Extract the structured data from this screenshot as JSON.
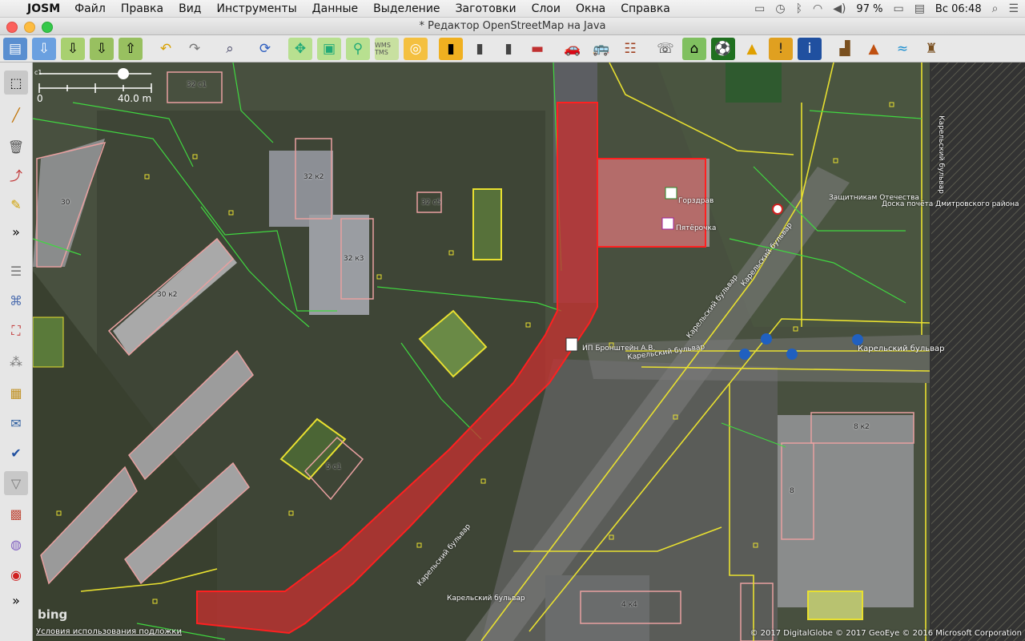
{
  "menubar": {
    "app": "JOSM",
    "items": [
      "Файл",
      "Правка",
      "Вид",
      "Инструменты",
      "Данные",
      "Выделение",
      "Заготовки",
      "Слои",
      "Окна",
      "Справка"
    ],
    "battery": "97 %",
    "clock": "Вс 06:48"
  },
  "window": {
    "title": "* Редактор OpenStreetMap на Java"
  },
  "toolbar": {
    "icons": [
      "open-icon",
      "save-icon",
      "download-icon",
      "download-area-icon",
      "upload-icon",
      "undo-icon",
      "redo-icon",
      "print-icon",
      "refresh-icon",
      "zoom-fit-icon",
      "zoom-selection-icon",
      "zoom-icon",
      "wms-tms-icon",
      "imagery-icon",
      "crossing-icon",
      "traffic-signal-icon",
      "barrier-icon",
      "wall-icon",
      "car-icon",
      "bus-icon",
      "railway-icon",
      "phone-icon",
      "building-icon",
      "sport-icon",
      "shop-icon",
      "warning-icon",
      "info-icon",
      "industrial-icon",
      "peak-icon",
      "water-icon",
      "castle-icon"
    ],
    "wms_label": "WMS TMS"
  },
  "left_tools": [
    "select-icon",
    "draw-way-icon",
    "delete-icon",
    "connect-icon",
    "pencil-icon",
    "more-icon",
    "layers-icon",
    "tag-icon",
    "relation-icon",
    "validator-icon",
    "notes-icon",
    "mail-icon",
    "check-icon",
    "filter-icon",
    "preset-icon",
    "style-icon",
    "map-marker-icon",
    "more-icon"
  ],
  "map": {
    "scale_zero": "0",
    "scale_len": "40.0 m",
    "scale_label_top": "c1",
    "bing": "bing",
    "terms": "Условия использования подложки",
    "attribution": "© 2017 DigitalGlobe © 2017 GeoEye © 2016 Microsoft Corporation",
    "labels": [
      {
        "t": "32 с1"
      },
      {
        "t": "32 к2"
      },
      {
        "t": "32 с5"
      },
      {
        "t": "32 к3"
      },
      {
        "t": "30 к2"
      },
      {
        "t": "30"
      },
      {
        "t": "Горздрав"
      },
      {
        "t": "Пятёрочка"
      },
      {
        "t": "5 с1"
      },
      {
        "t": "ИП Бронштейн А.В."
      },
      {
        "t": "Карельский бульвар"
      },
      {
        "t": "Карельский бульвар"
      },
      {
        "t": "Карельский бульвар"
      },
      {
        "t": "Карельский бульвар"
      },
      {
        "t": "Карельский бульвар"
      },
      {
        "t": "Защитникам Отечества"
      },
      {
        "t": "Доска почёта Дмитровского района"
      },
      {
        "t": "Карельский бульвар"
      },
      {
        "t": "8 к2"
      },
      {
        "t": "4 к4"
      },
      {
        "t": "Карельский бульвар"
      },
      {
        "t": "8"
      }
    ]
  },
  "colors": {
    "selection": "#e01818",
    "ways": "#e8e030",
    "footways": "#40d840",
    "buildings": "#d88080"
  }
}
